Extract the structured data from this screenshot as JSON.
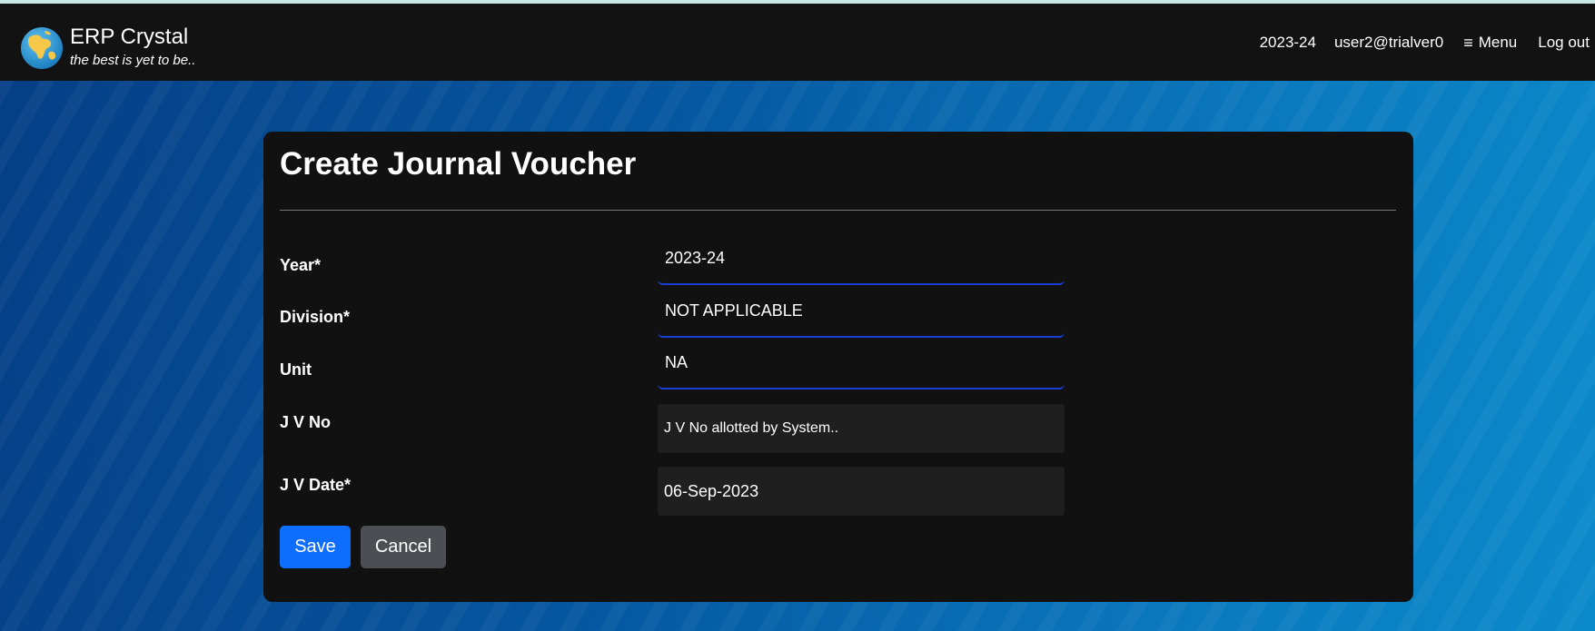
{
  "header": {
    "brand_name": "ERP Crystal",
    "tagline": "the best is yet to be..",
    "year": "2023-24",
    "user": "user2@trialver0",
    "menu_label": "Menu",
    "logout_label": "Log out"
  },
  "form": {
    "title": "Create Journal Voucher",
    "fields": [
      {
        "label": "Year*",
        "value": "2023-24"
      },
      {
        "label": "Division*",
        "value": "NOT APPLICABLE"
      },
      {
        "label": "Unit",
        "value": "NA"
      },
      {
        "label": "J V No",
        "value": "J V No allotted by System.."
      },
      {
        "label": "J V Date*",
        "value": "06-Sep-2023"
      }
    ],
    "save_label": "Save",
    "cancel_label": "Cancel"
  },
  "colors": {
    "navbar": "#121212",
    "card": "#111111",
    "primary_button": "#0d6efd",
    "secondary_button": "#4b4f54",
    "field_underline": "#1a3fd6",
    "background_blue": "#0557a0"
  },
  "icons": {
    "logo": "globe-icon",
    "menu": "hamburger-icon"
  }
}
